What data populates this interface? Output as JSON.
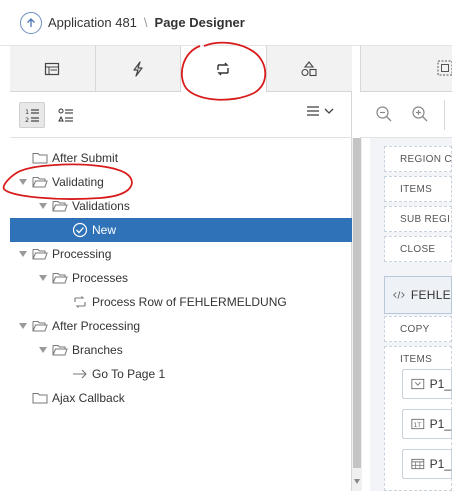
{
  "header": {
    "application": "Application 481",
    "separator": "\\",
    "current_page": "Page Designer"
  },
  "left_tabs": [
    {
      "icon": "rendering-icon",
      "active": false
    },
    {
      "icon": "dynamic-actions-icon",
      "active": false
    },
    {
      "icon": "processing-icon",
      "active": true
    },
    {
      "icon": "shared-components-icon",
      "active": false
    }
  ],
  "toolbar": {
    "view_buttons": [
      "tree-numbered-view-icon",
      "tree-list-view-icon"
    ],
    "menu_icon": "hamburger-menu-icon"
  },
  "tree": [
    {
      "label": "After Submit",
      "level": 0,
      "icon": "folder-icon",
      "expanded": false
    },
    {
      "label": "Validating",
      "level": 0,
      "icon": "open-folder-icon",
      "expanded": true
    },
    {
      "label": "Validations",
      "level": 1,
      "icon": "open-folder-icon",
      "expanded": true
    },
    {
      "label": "New",
      "level": 2,
      "icon": "check-circle-icon",
      "selected": true
    },
    {
      "label": "Processing",
      "level": 0,
      "icon": "open-folder-icon",
      "expanded": true
    },
    {
      "label": "Processes",
      "level": 1,
      "icon": "open-folder-icon",
      "expanded": true
    },
    {
      "label": "Process Row of FEHLERMELDUNG",
      "level": 2,
      "icon": "process-icon"
    },
    {
      "label": "After Processing",
      "level": 0,
      "icon": "open-folder-icon",
      "expanded": true
    },
    {
      "label": "Branches",
      "level": 1,
      "icon": "open-folder-icon",
      "expanded": true
    },
    {
      "label": "Go To Page 1",
      "level": 2,
      "icon": "arrow-right-icon"
    },
    {
      "label": "Ajax Callback",
      "level": 0,
      "icon": "folder-icon",
      "expanded": false
    }
  ],
  "right_pane": {
    "positions": [
      "REGION C",
      "ITEMS",
      "SUB REGI",
      "CLOSE"
    ],
    "region_title": "FEHLE",
    "region_positions": [
      "COPY",
      "ITEMS"
    ],
    "items": [
      {
        "label": "P1_",
        "icon": "select-list-icon"
      },
      {
        "label": "P1_",
        "icon": "number-field-icon"
      },
      {
        "label": "P1_",
        "icon": "date-picker-icon"
      }
    ]
  },
  "colors": {
    "selection": "#2f72b8",
    "annotation": "#d81b1b"
  }
}
